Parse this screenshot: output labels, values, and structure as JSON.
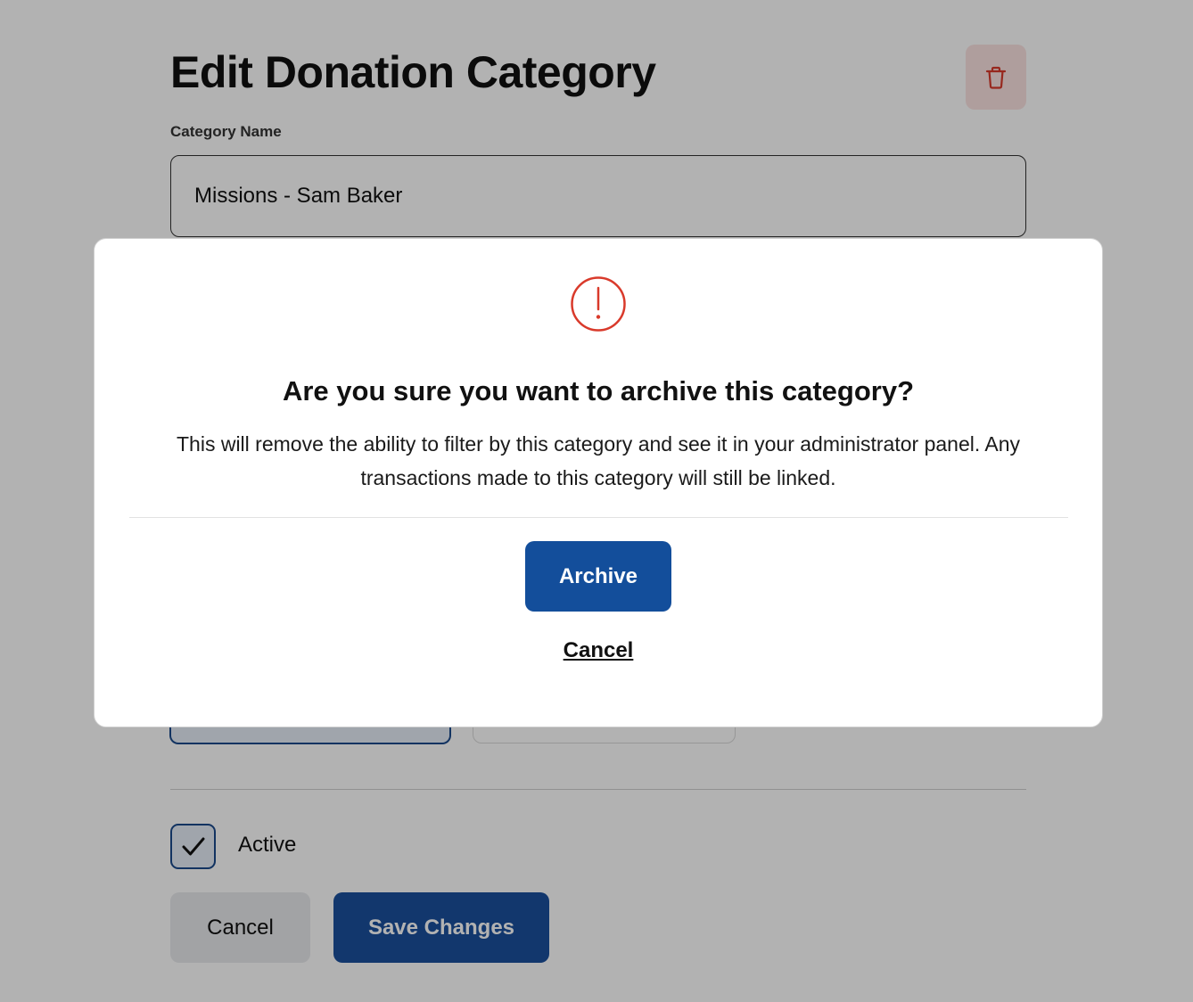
{
  "page": {
    "title": "Edit Donation Category",
    "delete_icon": "trash-icon",
    "category_name_label": "Category Name",
    "category_name_value": "Missions - Sam Baker",
    "active_label": "Active",
    "active_checked": true,
    "cancel_label": "Cancel",
    "save_label": "Save Changes"
  },
  "modal": {
    "icon": "exclamation-circle-icon",
    "title": "Are you sure you want to archive this category?",
    "body": "This will remove the ability to filter by this category and see it in your administrator panel. Any transactions made to this category will still be linked.",
    "archive_label": "Archive",
    "cancel_label": "Cancel"
  },
  "colors": {
    "primary": "#134e9b",
    "danger": "#d93a2b",
    "danger_bg": "#fbe3e1",
    "overlay": "rgba(0,0,0,0.30)"
  }
}
